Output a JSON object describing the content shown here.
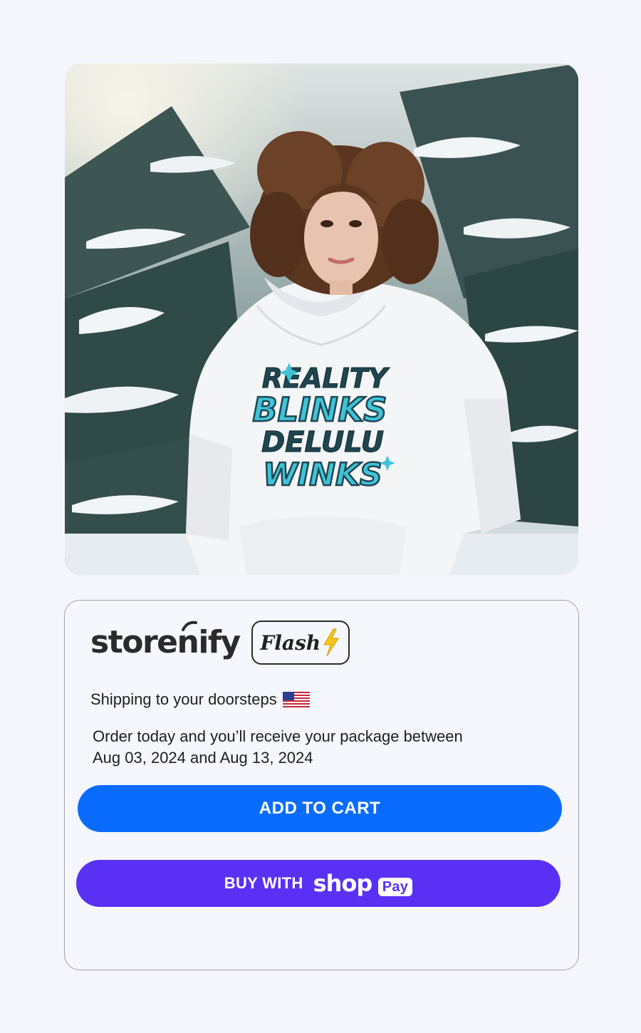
{
  "product_image": {
    "alt": "",
    "print_lines": [
      "REALITY",
      "BLINKS",
      "DELULU",
      "WINKS"
    ],
    "colors": {
      "hoodie": "#f4f5f7",
      "print_teal": "#3fc3d8",
      "print_dark": "#1f4650",
      "hair": "#5a3520",
      "snow": "#f2f5f7",
      "pine": "#2f4a47"
    }
  },
  "brand": {
    "name": "storenify",
    "badge_label": "Flash",
    "badge_icon": "lightning-bolt-icon",
    "colors": {
      "text": "#2b2b2b",
      "bolt": "#f5c518"
    }
  },
  "shipping": {
    "label": "Shipping to your doorsteps",
    "flag_icon": "us-flag-icon"
  },
  "delivery": {
    "line1": "Order today and you’ll receive your package between",
    "line2": "Aug 03, 2024 and Aug 13, 2024"
  },
  "actions": {
    "add_to_cart": "ADD TO CART",
    "buy_with": "BUY WITH",
    "shop_word": "shop",
    "pay_word": "Pay",
    "colors": {
      "cart": "#0a6cff",
      "shop": "#5a31f4"
    }
  }
}
